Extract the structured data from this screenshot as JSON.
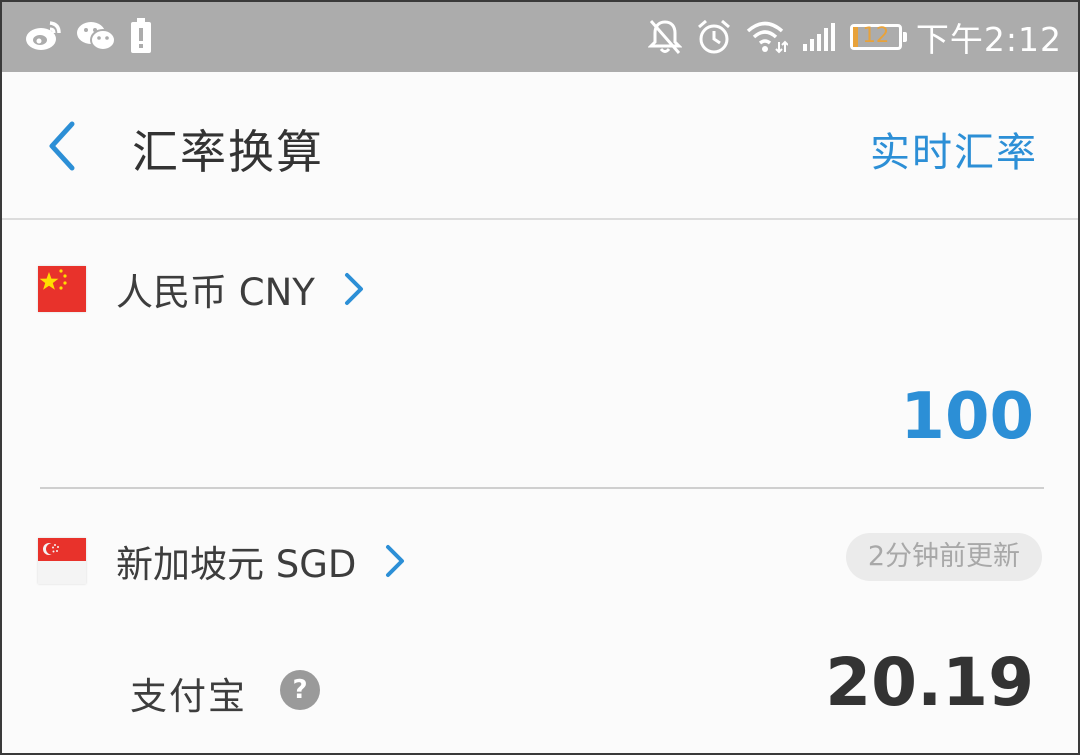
{
  "status_bar": {
    "left_icons": [
      "weibo-icon",
      "wechat-icon",
      "battery-alert-icon"
    ],
    "right_icons": [
      "mute-icon",
      "alarm-icon",
      "wifi-icon",
      "signal-icon"
    ],
    "battery_level": "12",
    "time": "下午2:12",
    "battery_color": "#e8a23a"
  },
  "header": {
    "back_icon": "chevron-left-icon",
    "title": "汇率换算",
    "realtime_label": "实时汇率"
  },
  "from_currency": {
    "flag_icon": "china-flag-icon",
    "name": "人民币 CNY",
    "amount": "100"
  },
  "to_currency": {
    "flag_icon": "singapore-flag-icon",
    "name": "新加坡元 SGD",
    "updated": "2分钟前更新",
    "provider": "支付宝",
    "help_glyph": "?",
    "amount": "20.19"
  },
  "colors": {
    "accent": "#2c8fd6",
    "status_bar": "#acacac",
    "text": "#333333"
  }
}
